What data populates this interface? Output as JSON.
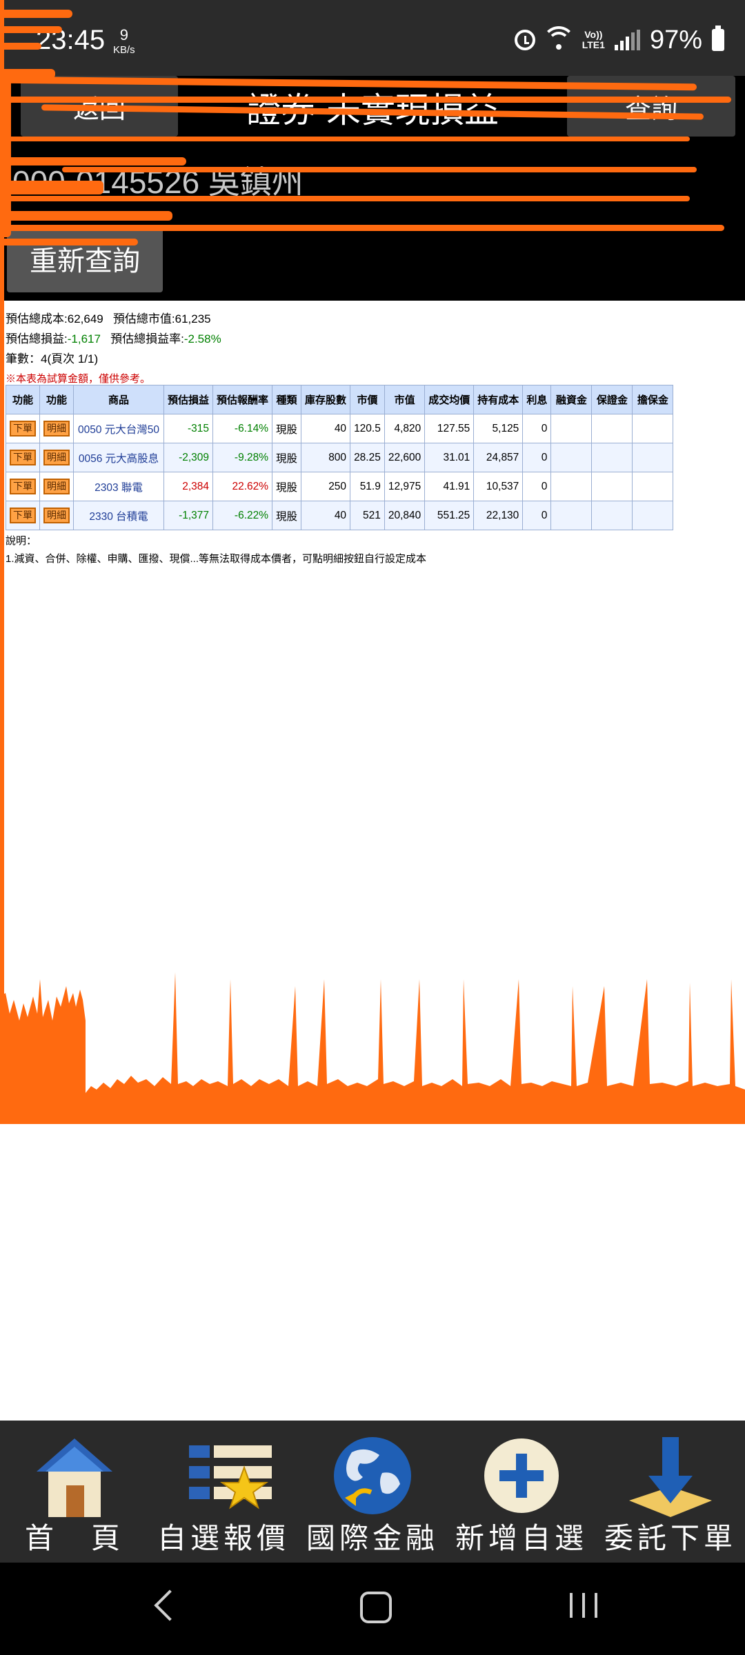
{
  "status_bar": {
    "time": "23:45",
    "net_speed": "9",
    "net_unit": "KB/s",
    "lte_top": "Vo))",
    "lte_bottom": "LTE1",
    "battery": "97%"
  },
  "header": {
    "back_label": "返回",
    "title": "證券 未實現損益",
    "query_label": "查詢",
    "account": "000-0145526 吳鎮州",
    "requery_label": "重新查詢"
  },
  "summary": {
    "cost_label": "預估總成本:",
    "cost_value": "62,649",
    "market_label": "預估總市值:",
    "market_value": "61,235",
    "pl_label": "預估總損益:",
    "pl_value": "-1,617",
    "rate_label": "預估總損益率:",
    "rate_value": "-2.58%",
    "count": "筆數：4(頁次 1/1)",
    "note": "※本表為試算金額，僅供參考。"
  },
  "table": {
    "headers": [
      "功能",
      "功能",
      "商品",
      "預估損益",
      "預估報酬率",
      "種類",
      "庫存股數",
      "市價",
      "市值",
      "成交均價",
      "持有成本",
      "利息",
      "融資金",
      "保證金",
      "擔保金"
    ],
    "order_label": "下單",
    "detail_label": "明細",
    "rows": [
      {
        "product": "0050 元大台灣50",
        "pl": "-315",
        "rate": "-6.14%",
        "type": "現股",
        "shares": "40",
        "price": "120.5",
        "value": "4,820",
        "avg": "127.55",
        "cost": "5,125",
        "interest": "0"
      },
      {
        "product": "0056 元大高股息",
        "pl": "-2,309",
        "rate": "-9.28%",
        "type": "現股",
        "shares": "800",
        "price": "28.25",
        "value": "22,600",
        "avg": "31.01",
        "cost": "24,857",
        "interest": "0"
      },
      {
        "product": "2303 聯電",
        "pl": "2,384",
        "rate": "22.62%",
        "type": "現股",
        "shares": "250",
        "price": "51.9",
        "value": "12,975",
        "avg": "41.91",
        "cost": "10,537",
        "interest": "0"
      },
      {
        "product": "2330 台積電",
        "pl": "-1,377",
        "rate": "-6.22%",
        "type": "現股",
        "shares": "40",
        "price": "521",
        "value": "20,840",
        "avg": "551.25",
        "cost": "22,130",
        "interest": "0"
      }
    ]
  },
  "explanation": {
    "title": "說明：",
    "line1": "1.減資、合併、除權、申購、匯撥、現償...等無法取得成本價者，可點明細按鈕自行設定成本"
  },
  "toolbar": {
    "home": "首　頁",
    "watchlist": "自選報價",
    "international": "國際金融",
    "add_watch": "新增自選",
    "order": "委託下單"
  },
  "colors": {
    "header_bg": "#000000",
    "scribble": "#ff6a10",
    "table_header": "#cfe0fb",
    "loss": "#008000",
    "gain": "#cc0000"
  }
}
